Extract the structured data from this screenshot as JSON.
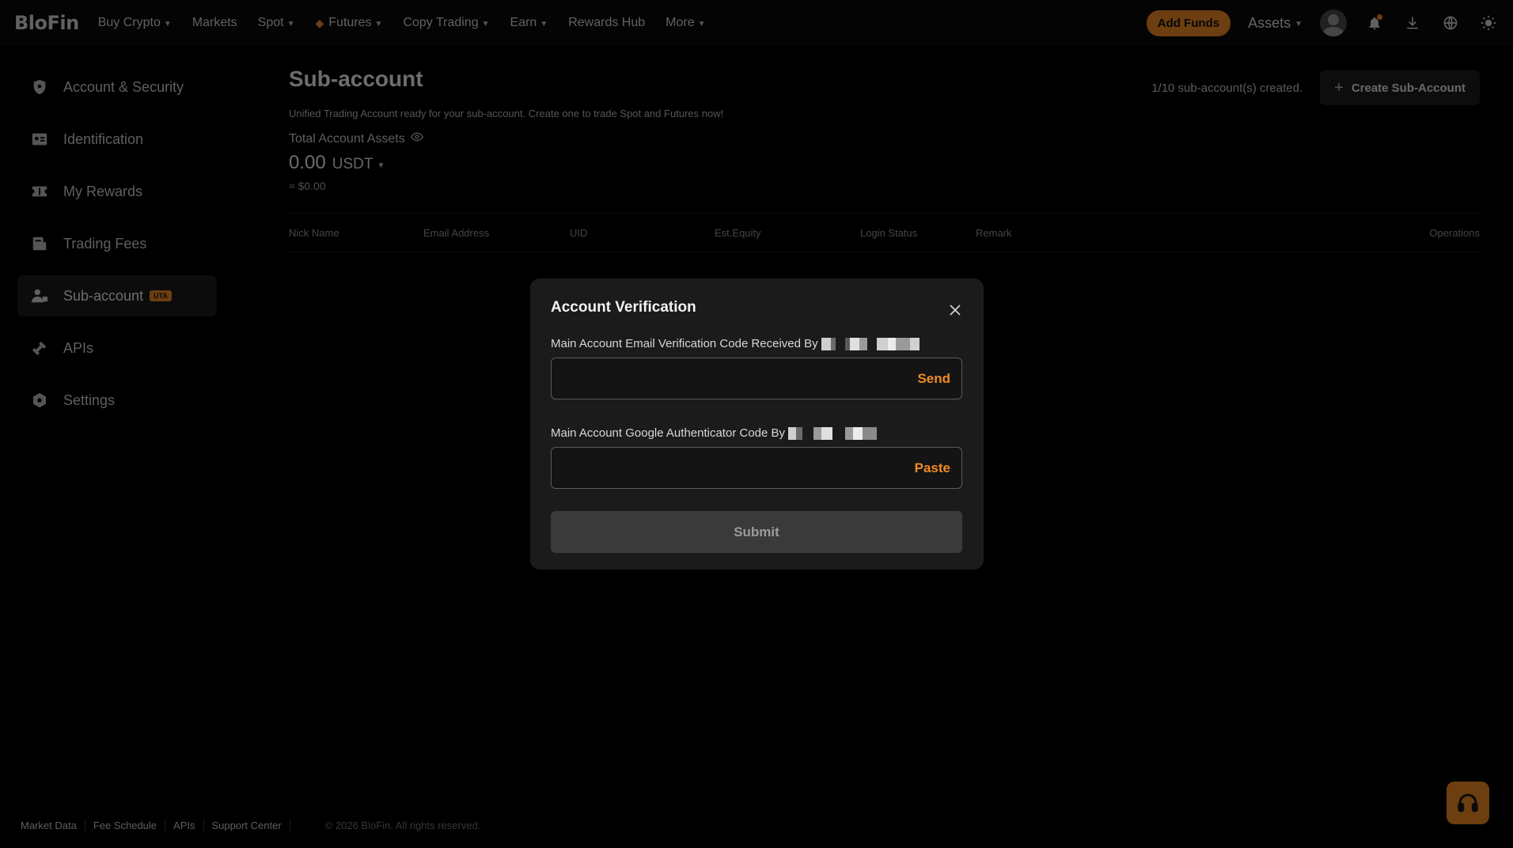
{
  "nav": {
    "logo": "BloFin",
    "items": [
      {
        "label": "Buy Crypto",
        "dropdown": true
      },
      {
        "label": "Markets",
        "dropdown": false
      },
      {
        "label": "Spot",
        "dropdown": true
      },
      {
        "label": "Futures",
        "dropdown": true
      },
      {
        "label": "Copy Trading",
        "dropdown": true
      },
      {
        "label": "Earn",
        "dropdown": true
      },
      {
        "label": "Rewards Hub",
        "dropdown": false
      },
      {
        "label": "More",
        "dropdown": true
      }
    ],
    "add_funds": "Add Funds",
    "assets": "Assets"
  },
  "sidebar": {
    "items": [
      {
        "label": "Account & Security",
        "icon": "shield-icon"
      },
      {
        "label": "Identification",
        "icon": "id-card-icon"
      },
      {
        "label": "My Rewards",
        "icon": "ticket-icon"
      },
      {
        "label": "Trading Fees",
        "icon": "fees-icon"
      },
      {
        "label": "Sub-account",
        "icon": "sub-account-icon",
        "badge": "UTA",
        "active": true
      },
      {
        "label": "APIs",
        "icon": "api-icon"
      },
      {
        "label": "Settings",
        "icon": "settings-icon"
      }
    ]
  },
  "main": {
    "title": "Sub-account",
    "count_text": "1/10 sub-account(s) created.",
    "create_button": "Create Sub-Account",
    "subtitle": "Unified Trading Account ready for your sub-account. Create one to trade Spot and Futures now!",
    "assets_label": "Total Account Assets",
    "amount": "0.00",
    "currency": "USDT",
    "approx": "≈ $0.00",
    "table_headers": [
      "Nick Name",
      "Email Address",
      "UID",
      "Est.Equity",
      "Login Status",
      "Remark",
      "Operations"
    ]
  },
  "modal": {
    "title": "Account Verification",
    "email_label": "Main Account Email Verification Code Received By",
    "email_action": "Send",
    "email_placeholder": "",
    "google_label": "Main Account Google Authenticator Code By",
    "google_action": "Paste",
    "google_placeholder": "",
    "submit": "Submit"
  },
  "footer": {
    "links": [
      "Market Data",
      "Fee Schedule",
      "APIs",
      "Support Center"
    ],
    "copyright": "© 2026 BloFin. All rights reserved."
  },
  "colors": {
    "accent": "#f08a24",
    "background": "#000000",
    "modal_bg": "#1b1b1b"
  }
}
